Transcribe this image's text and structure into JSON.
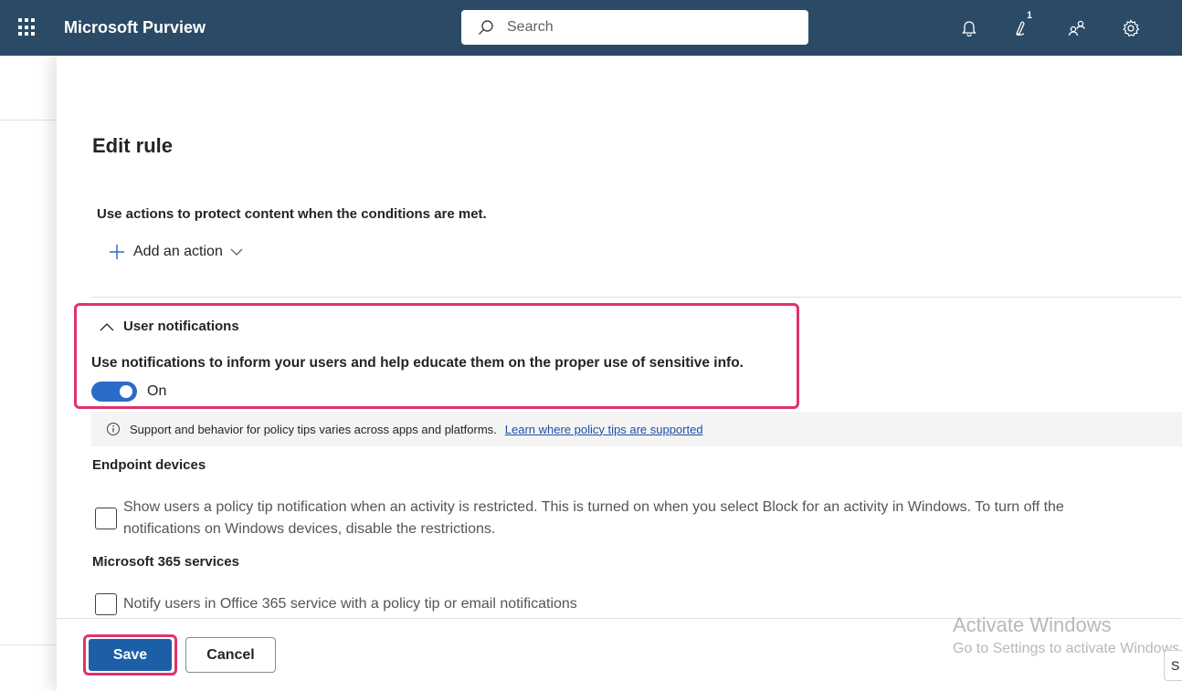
{
  "app": {
    "title": "Microsoft Purview"
  },
  "search": {
    "placeholder": "Search"
  },
  "topbar": {
    "notification_badge": "1",
    "icons": [
      "bell-icon",
      "help-assistant-icon",
      "community-icon",
      "settings-icon"
    ]
  },
  "panel": {
    "title": "Edit rule",
    "subtitle": "Use actions to protect content when the conditions are met.",
    "add_action_label": "Add an action"
  },
  "user_notifications": {
    "header": "User notifications",
    "description": "Use notifications to inform your users and help educate them on the proper use of sensitive info.",
    "toggle_label": "On",
    "toggle_state": true
  },
  "info": {
    "text": "Support and behavior for policy tips varies across apps and platforms.",
    "link": "Learn where policy tips are supported"
  },
  "endpoint": {
    "heading": "Endpoint devices",
    "checkbox_line1": "Show users a policy tip notification when an activity is restricted. This is turned on when you select Block for an activity in Windows. To turn off the",
    "checkbox_line2": "notifications on Windows devices, disable the restrictions."
  },
  "m365": {
    "heading": "Microsoft 365 services",
    "checkbox_label": "Notify users in Office 365 service with a policy tip or email notifications"
  },
  "footer": {
    "save_label": "Save",
    "cancel_label": "Cancel"
  },
  "watermark": {
    "line1": "Activate Windows",
    "line2": "Go to Settings to activate Windows."
  },
  "corner": {
    "label": "S"
  },
  "colors": {
    "topbar": "#2b4a66",
    "accent": "#1d5fa6",
    "highlight": "#e0336b",
    "toggle": "#2b6bc9"
  }
}
